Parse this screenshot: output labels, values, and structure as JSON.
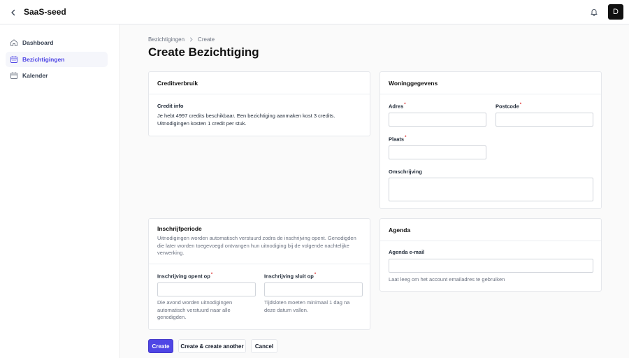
{
  "app": {
    "title": "SaaS-seed",
    "avatar_initial": "D"
  },
  "sidebar": {
    "items": [
      {
        "label": "Dashboard",
        "icon": "home-icon",
        "active": false
      },
      {
        "label": "Bezichtigingen",
        "icon": "calendar-icon",
        "active": true
      },
      {
        "label": "Kalender",
        "icon": "calendar-icon",
        "active": false
      }
    ]
  },
  "breadcrumb": {
    "parent": "Bezichtigingen",
    "current": "Create"
  },
  "page": {
    "title": "Create Bezichtiging"
  },
  "credit": {
    "header": "Creditverbruik",
    "info_label": "Credit info",
    "info_text": "Je hebt 4997 credits beschikbaar. Een bezichtiging aanmaken kost 3 credits. Uitnodigingen kosten 1 credit per stuk."
  },
  "woning": {
    "header": "Woninggegevens",
    "adres_label": "Adres",
    "adres_value": "",
    "postcode_label": "Postcode",
    "postcode_value": "",
    "plaats_label": "Plaats",
    "plaats_value": "",
    "omschrijving_label": "Omschrijving",
    "omschrijving_value": "",
    "required_mark": "*"
  },
  "inschrijf": {
    "header": "Inschrijfperiode",
    "description": "Uitnodigingen worden automatisch verstuurd zodra de inschrijving opent. Genodigden die later worden toegevoegd ontvangen hun uitnodiging bij de volgende nachtelijke verwerking.",
    "open_label": "Inschrijving opent op",
    "open_value": "",
    "open_help": "Die avond worden uitnodigingen automatisch verstuurd naar alle genodigden.",
    "close_label": "Inschrijving sluit op",
    "close_value": "",
    "close_help": "Tijdsloten moeten minimaal 1 dag na deze datum vallen.",
    "required_mark": "*"
  },
  "agenda": {
    "header": "Agenda",
    "email_label": "Agenda e-mail",
    "email_value": "",
    "email_help": "Laat leeg om het account emailadres te gebruiken"
  },
  "actions": {
    "create": "Create",
    "create_another": "Create & create another",
    "cancel": "Cancel"
  },
  "colors": {
    "accent": "#4f46e5",
    "required": "#dc2626"
  }
}
